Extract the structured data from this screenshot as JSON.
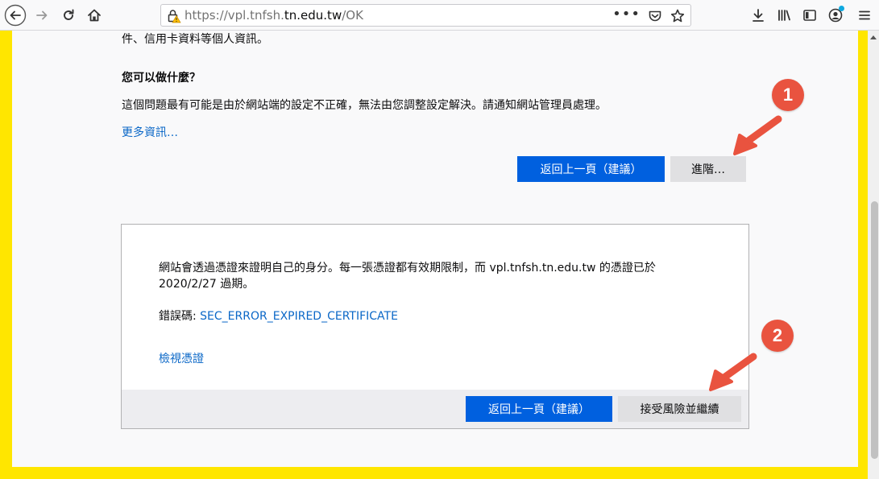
{
  "browser": {
    "url_prefix": "https://vpl.tnfsh.",
    "url_host": "tn.edu.tw",
    "url_path": "/OK",
    "page_actions": "•••"
  },
  "page": {
    "top_cut_text": "件、信用卡資料等個人資訊。",
    "heading": "您可以做什麼？",
    "description": "這個問題最有可能是由於網站端的設定不正確，無法由您調整設定解決。請通知網站管理員處理。",
    "more_info": "更多資訊…",
    "back_button": "返回上一頁（建議）",
    "advanced_button": "進階…"
  },
  "advanced": {
    "text_line1": "網站會透過憑證來證明自己的身分。每一張憑證都有效期限制，而 vpl.tnfsh.tn.edu.tw 的憑證已於",
    "text_line2": "2020/2/27 過期。",
    "error_label": "錯誤碼: ",
    "error_code": "SEC_ERROR_EXPIRED_CERTIFICATE",
    "view_cert": "檢視憑證",
    "back_button": "返回上一頁（建議）",
    "accept_button": "接受風險並繼續"
  },
  "annotations": {
    "badge1": "1",
    "badge2": "2",
    "color": "#e9533f"
  },
  "colors": {
    "frame": "#ffe600",
    "primary_button": "#0060df",
    "link": "#0a67c7"
  }
}
